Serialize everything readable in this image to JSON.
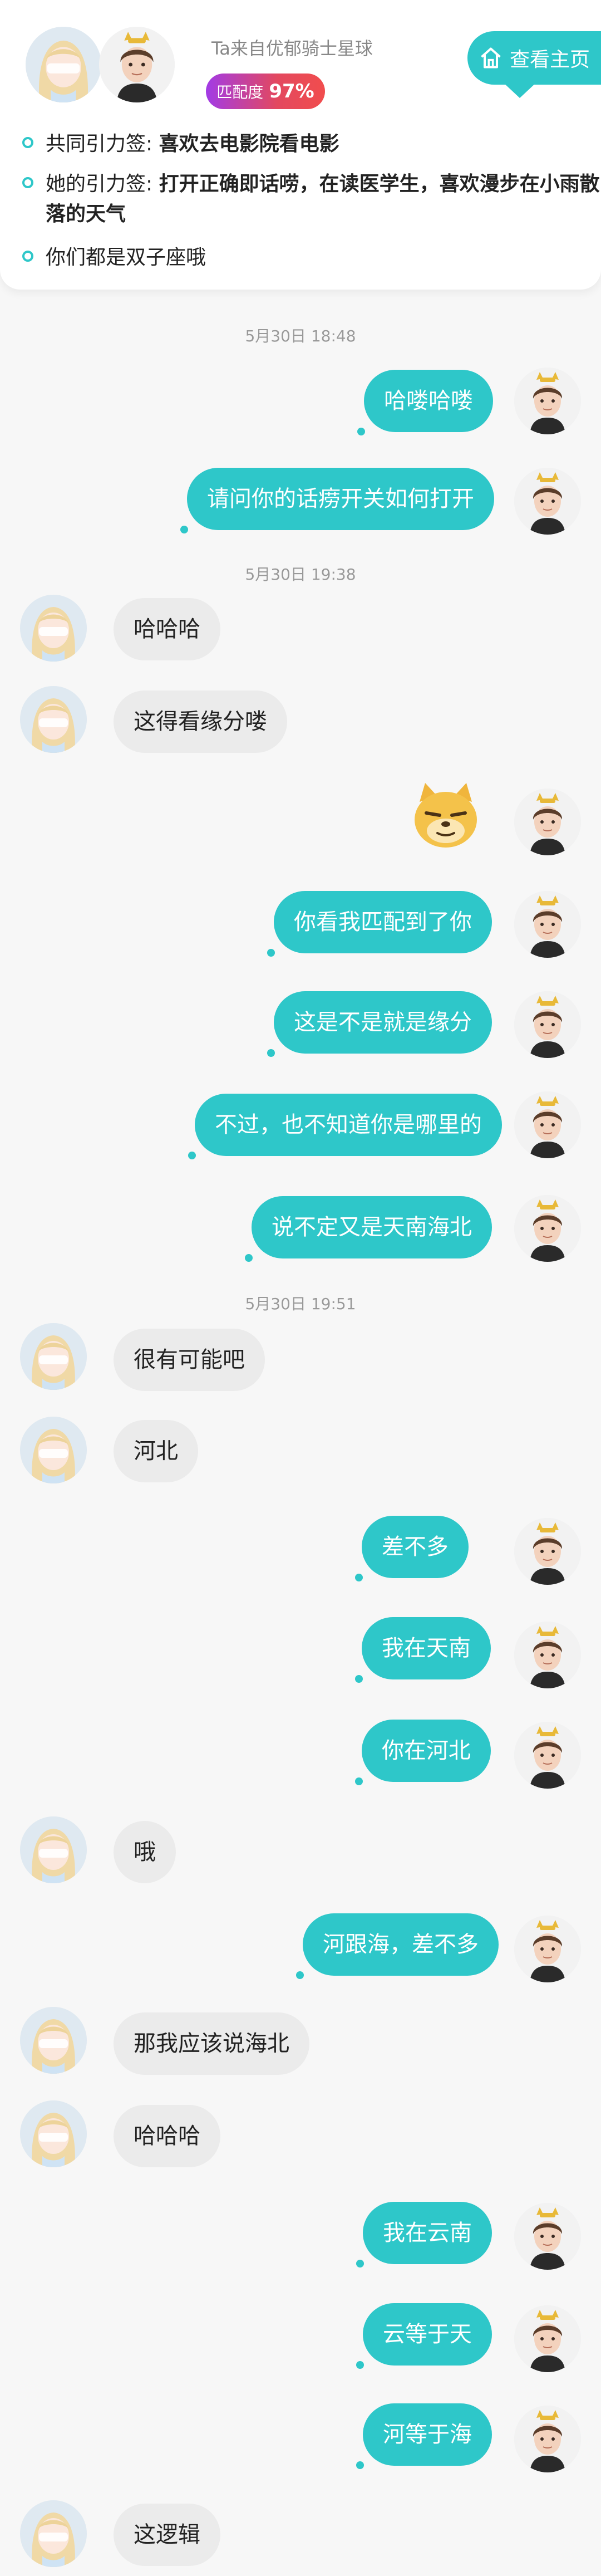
{
  "header": {
    "origin_text": "Ta来自优郁骑士星球",
    "match_label": "匹配度",
    "match_value": "97%",
    "homepage_button": "查看主页",
    "tags": [
      {
        "label": "共同引力签:",
        "value": "喜欢去电影院看电影"
      },
      {
        "label": "她的引力签:",
        "value": "打开正确即话唠，在读医学生，喜欢漫步在小雨散落的天气"
      },
      {
        "text": "你们都是双子座哦"
      }
    ]
  },
  "chat": {
    "times": [
      "5月30日 18:48",
      "5月30日 19:38",
      "5月30日 19:51"
    ],
    "messages": [
      {
        "from": "me",
        "text": "哈喽哈喽"
      },
      {
        "from": "me",
        "text": "请问你的话痨开关如何打开"
      },
      {
        "from": "her",
        "text": "哈哈哈"
      },
      {
        "from": "her",
        "text": "这得看缘分喽"
      },
      {
        "from": "me",
        "type": "sticker",
        "sticker": "smug-dog-emoji"
      },
      {
        "from": "me",
        "text": "你看我匹配到了你"
      },
      {
        "from": "me",
        "text": "这是不是就是缘分"
      },
      {
        "from": "me",
        "text": "不过，也不知道你是哪里的"
      },
      {
        "from": "me",
        "text": "说不定又是天南海北"
      },
      {
        "from": "her",
        "text": "很有可能吧"
      },
      {
        "from": "her",
        "text": "河北"
      },
      {
        "from": "me",
        "text": "差不多"
      },
      {
        "from": "me",
        "text": "我在天南"
      },
      {
        "from": "me",
        "text": "你在河北"
      },
      {
        "from": "her",
        "text": "哦"
      },
      {
        "from": "me",
        "text": "河跟海，差不多"
      },
      {
        "from": "her",
        "text": "那我应该说海北"
      },
      {
        "from": "her",
        "text": "哈哈哈"
      },
      {
        "from": "me",
        "text": "我在云南"
      },
      {
        "from": "me",
        "text": "云等于天"
      },
      {
        "from": "me",
        "text": "河等于海"
      },
      {
        "from": "her",
        "text": "这逻辑"
      }
    ]
  },
  "colors": {
    "accent": "#2ec7c9",
    "her_bubble": "#ebebeb",
    "background": "#f7f7f7"
  }
}
